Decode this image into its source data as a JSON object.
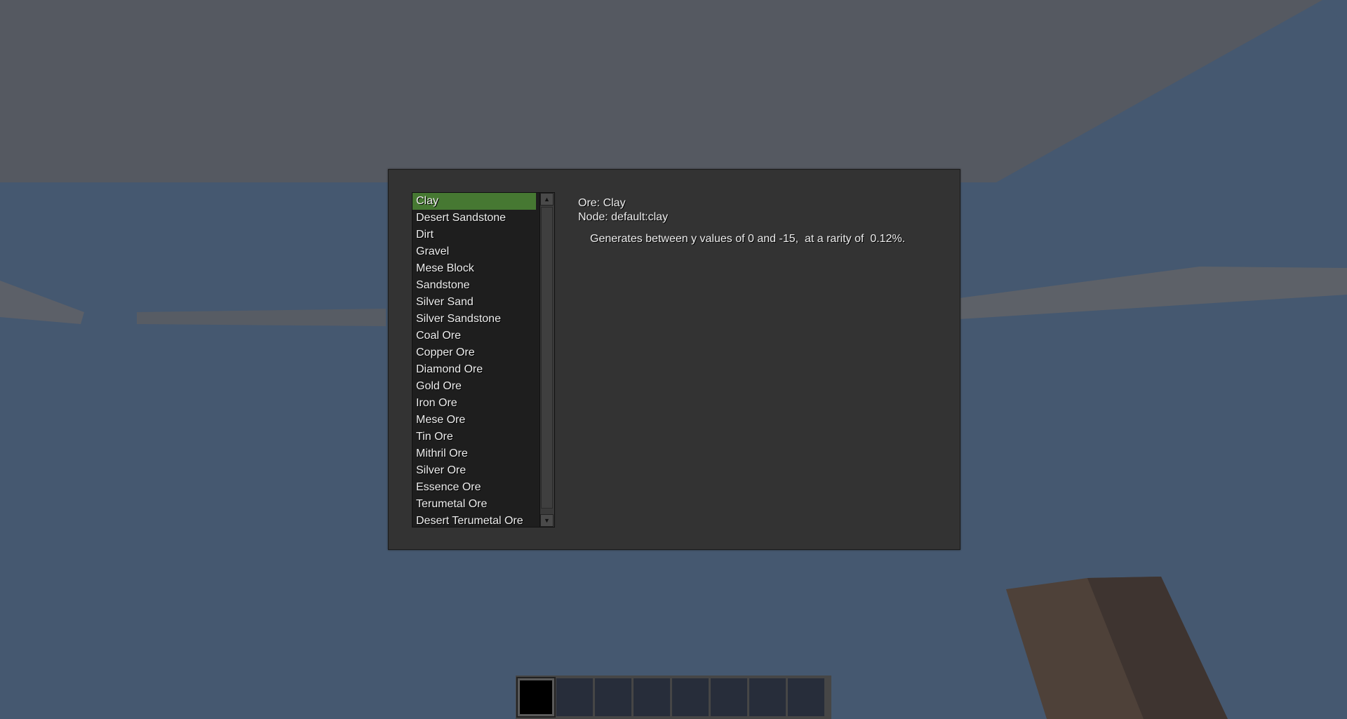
{
  "ore_list": {
    "selected": "Clay",
    "items": [
      "Clay",
      "Desert Sandstone",
      "Dirt",
      "Gravel",
      "Mese Block",
      "Sandstone",
      "Silver Sand",
      "Silver Sandstone",
      "Coal Ore",
      "Copper Ore",
      "Diamond Ore",
      "Gold Ore",
      "Iron Ore",
      "Mese Ore",
      "Tin Ore",
      "Mithril Ore",
      "Silver Ore",
      "Essence Ore",
      "Terumetal Ore",
      "Desert Terumetal Ore"
    ]
  },
  "details": {
    "ore_line": "Ore: Clay",
    "node_line": "Node: default:clay",
    "generation_line": "Generates between y values of 0 and -15,  at a rarity of  0.12%."
  },
  "hotbar": {
    "slots": 8,
    "selected_slot": 1
  },
  "colors": {
    "selected_row": "#467832",
    "dialog_bg": "#333333",
    "sky": "#555961",
    "water": "#455870"
  }
}
